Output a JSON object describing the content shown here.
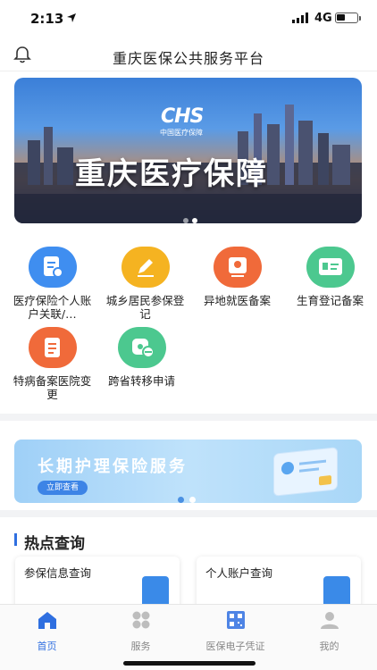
{
  "status": {
    "time": "2:13",
    "network": "4G"
  },
  "header": {
    "title": "重庆医保公共服务平台",
    "bell_icon": "bell-icon"
  },
  "banner": {
    "logo": "CHS",
    "logo_sub": "中国医疗保障",
    "title": "重庆医疗保障"
  },
  "services": [
    {
      "label": "医疗保险个人账户关联/…",
      "icon": "document-link-icon",
      "color": "#3f8ef0"
    },
    {
      "label": "城乡居民参保登记",
      "icon": "edit-icon",
      "color": "#f5b321"
    },
    {
      "label": "异地就医备案",
      "icon": "location-icon",
      "color": "#f06a3a"
    },
    {
      "label": "生育登记备案",
      "icon": "id-card-icon",
      "color": "#4cc88f"
    },
    {
      "label": "特病备案医院变更",
      "icon": "file-edit-icon",
      "color": "#f06a3a"
    },
    {
      "label": "跨省转移申请",
      "icon": "transfer-icon",
      "color": "#4cc88f"
    }
  ],
  "promo": {
    "title": "长期护理保险服务",
    "button": "立即查看"
  },
  "hot": {
    "title": "热点查询",
    "cards": [
      {
        "label": "参保信息查询"
      },
      {
        "label": "个人账户查询"
      }
    ]
  },
  "tabs": [
    {
      "label": "首页",
      "icon": "home-icon",
      "active": true
    },
    {
      "label": "服务",
      "icon": "grid-icon",
      "active": false
    },
    {
      "label": "医保电子凭证",
      "icon": "qr-code-icon",
      "active": false
    },
    {
      "label": "我的",
      "icon": "user-icon",
      "active": false
    }
  ],
  "colors": {
    "accent": "#2f6fe0",
    "inactive": "#b8b8b8"
  }
}
